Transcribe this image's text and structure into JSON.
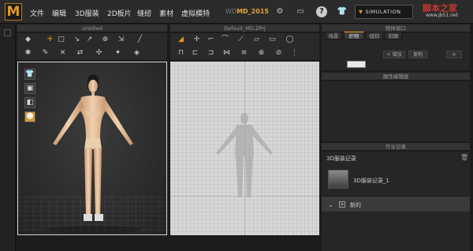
{
  "app": {
    "logo": "M",
    "project_prefix": "WD",
    "project": "MD_2015"
  },
  "menu": [
    "文件",
    "编辑",
    "3D服装",
    "2D板片",
    "缝纫",
    "素材",
    "虚拟模特"
  ],
  "toolbar_right": {
    "help_icon": "?",
    "simulation_label": "SIMULATION"
  },
  "watermark": {
    "text": "脚本之家",
    "url": "www.jb51.net"
  },
  "panels": {
    "view3d_title": "Untitled",
    "view2d_title": "Default_MD.ZPrj",
    "object_window_title": "物体窗口",
    "object_tabs": [
      "场景",
      "织物",
      "纽扣",
      "扣眼"
    ],
    "add_button": "+ 增加",
    "copy_button": "复制",
    "property_title": "属性编辑器",
    "history_title": "作业记录",
    "history_header": "3D服装记录",
    "history_item": "3D服装记录_1",
    "new_label": "新的"
  },
  "colors": {
    "accent": "#e69a1c",
    "watermark": "#c7392f"
  }
}
